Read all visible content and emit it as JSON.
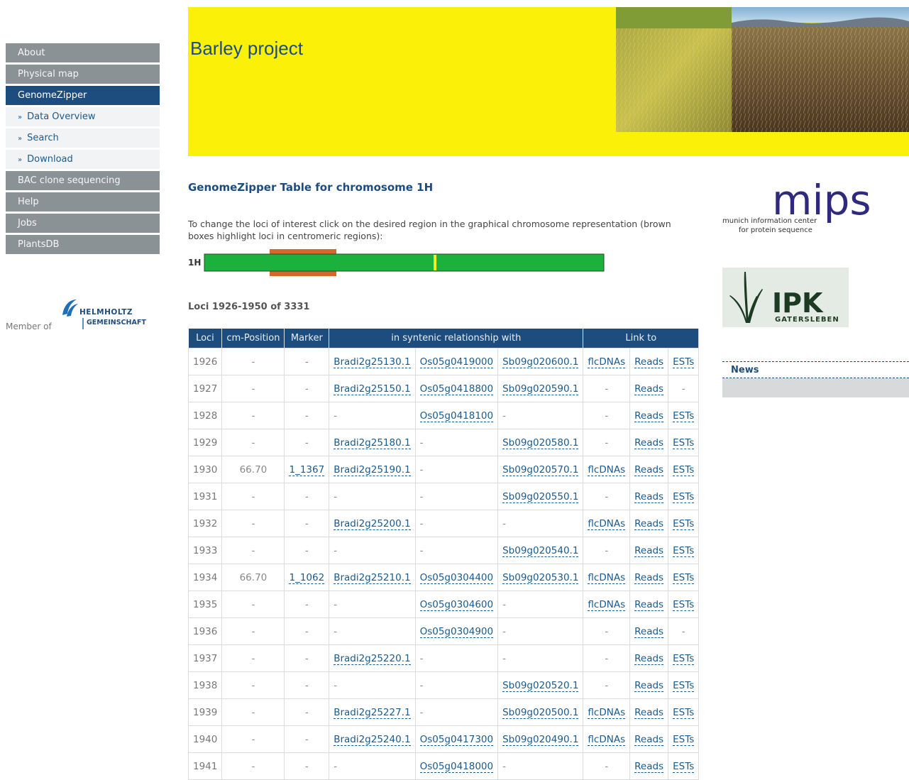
{
  "sidebar": {
    "items": [
      {
        "label": "About"
      },
      {
        "label": "Physical map"
      },
      {
        "label": "GenomeZipper"
      },
      {
        "label": "BAC clone sequencing"
      },
      {
        "label": "Help"
      },
      {
        "label": "Jobs"
      },
      {
        "label": "PlantsDB"
      }
    ],
    "subitems": [
      {
        "label": "Data Overview"
      },
      {
        "label": "Search"
      },
      {
        "label": "Download"
      }
    ],
    "member_of": "Member of",
    "helmholtz_line1": "HELMHOLTZ",
    "helmholtz_line2": "GEMEINSCHAFT"
  },
  "banner": {
    "title": "Barley project"
  },
  "main": {
    "title": "GenomeZipper Table for chromosome 1H",
    "instructions": "To change the loci of interest click on the desired region in the graphical chromosome representation (brown boxes highlight loci in centromeric regions):",
    "chromosome_label": "1H",
    "loci_range": "Loci 1926-1950  of  3331"
  },
  "table": {
    "headers": [
      "Loci",
      "cm-Position",
      "Marker",
      "in syntenic relationship with",
      "Link to"
    ],
    "rows": [
      {
        "locus": "1926",
        "cm": "-",
        "marker": "-",
        "bradi": "Bradi2g25130.1",
        "os": "Os05g0419000",
        "sb": "Sb09g020600.1",
        "flc": "flcDNAs",
        "reads": "Reads",
        "ests": "ESTs"
      },
      {
        "locus": "1927",
        "cm": "-",
        "marker": "-",
        "bradi": "Bradi2g25150.1",
        "os": "Os05g0418800",
        "sb": "Sb09g020590.1",
        "flc": "-",
        "reads": "Reads",
        "ests": "-"
      },
      {
        "locus": "1928",
        "cm": "-",
        "marker": "-",
        "bradi": "-",
        "os": "Os05g0418100",
        "sb": "-",
        "flc": "-",
        "reads": "Reads",
        "ests": "ESTs"
      },
      {
        "locus": "1929",
        "cm": "-",
        "marker": "-",
        "bradi": "Bradi2g25180.1",
        "os": "-",
        "sb": "Sb09g020580.1",
        "flc": "-",
        "reads": "Reads",
        "ests": "ESTs"
      },
      {
        "locus": "1930",
        "cm": "66.70",
        "marker": "1_1367",
        "bradi": "Bradi2g25190.1",
        "os": "-",
        "sb": "Sb09g020570.1",
        "flc": "flcDNAs",
        "reads": "Reads",
        "ests": "ESTs"
      },
      {
        "locus": "1931",
        "cm": "-",
        "marker": "-",
        "bradi": "-",
        "os": "-",
        "sb": "Sb09g020550.1",
        "flc": "-",
        "reads": "Reads",
        "ests": "ESTs"
      },
      {
        "locus": "1932",
        "cm": "-",
        "marker": "-",
        "bradi": "Bradi2g25200.1",
        "os": "-",
        "sb": "-",
        "flc": "flcDNAs",
        "reads": "Reads",
        "ests": "ESTs"
      },
      {
        "locus": "1933",
        "cm": "-",
        "marker": "-",
        "bradi": "-",
        "os": "-",
        "sb": "Sb09g020540.1",
        "flc": "-",
        "reads": "Reads",
        "ests": "ESTs"
      },
      {
        "locus": "1934",
        "cm": "66.70",
        "marker": "1_1062",
        "bradi": "Bradi2g25210.1",
        "os": "Os05g0304400",
        "sb": "Sb09g020530.1",
        "flc": "flcDNAs",
        "reads": "Reads",
        "ests": "ESTs"
      },
      {
        "locus": "1935",
        "cm": "-",
        "marker": "-",
        "bradi": "-",
        "os": "Os05g0304600",
        "sb": "-",
        "flc": "flcDNAs",
        "reads": "Reads",
        "ests": "ESTs"
      },
      {
        "locus": "1936",
        "cm": "-",
        "marker": "-",
        "bradi": "-",
        "os": "Os05g0304900",
        "sb": "-",
        "flc": "-",
        "reads": "Reads",
        "ests": "-"
      },
      {
        "locus": "1937",
        "cm": "-",
        "marker": "-",
        "bradi": "Bradi2g25220.1",
        "os": "-",
        "sb": "-",
        "flc": "-",
        "reads": "Reads",
        "ests": "ESTs"
      },
      {
        "locus": "1938",
        "cm": "-",
        "marker": "-",
        "bradi": "-",
        "os": "-",
        "sb": "Sb09g020520.1",
        "flc": "-",
        "reads": "Reads",
        "ests": "ESTs"
      },
      {
        "locus": "1939",
        "cm": "-",
        "marker": "-",
        "bradi": "Bradi2g25227.1",
        "os": "-",
        "sb": "Sb09g020500.1",
        "flc": "flcDNAs",
        "reads": "Reads",
        "ests": "ESTs"
      },
      {
        "locus": "1940",
        "cm": "-",
        "marker": "-",
        "bradi": "Bradi2g25240.1",
        "os": "Os05g0417300",
        "sb": "Sb09g020490.1",
        "flc": "flcDNAs",
        "reads": "Reads",
        "ests": "ESTs"
      },
      {
        "locus": "1941",
        "cm": "-",
        "marker": "-",
        "bradi": "-",
        "os": "Os05g0418000",
        "sb": "-",
        "flc": "-",
        "reads": "Reads",
        "ests": "ESTs"
      }
    ]
  },
  "right": {
    "mips_logo": "mips",
    "mips_line1": "munich information center",
    "mips_line2": "for protein sequence",
    "ipk_logo": "IPK",
    "ipk_sub": "GATERSLEBEN",
    "news_label": "News"
  },
  "colors": {
    "nav": "#8a9296",
    "nav_active": "#1d4d7e",
    "banner": "#fbf008",
    "chromosome": "#1ab23c",
    "centromere": "#d8672a",
    "marker": "#f4ee1c"
  }
}
